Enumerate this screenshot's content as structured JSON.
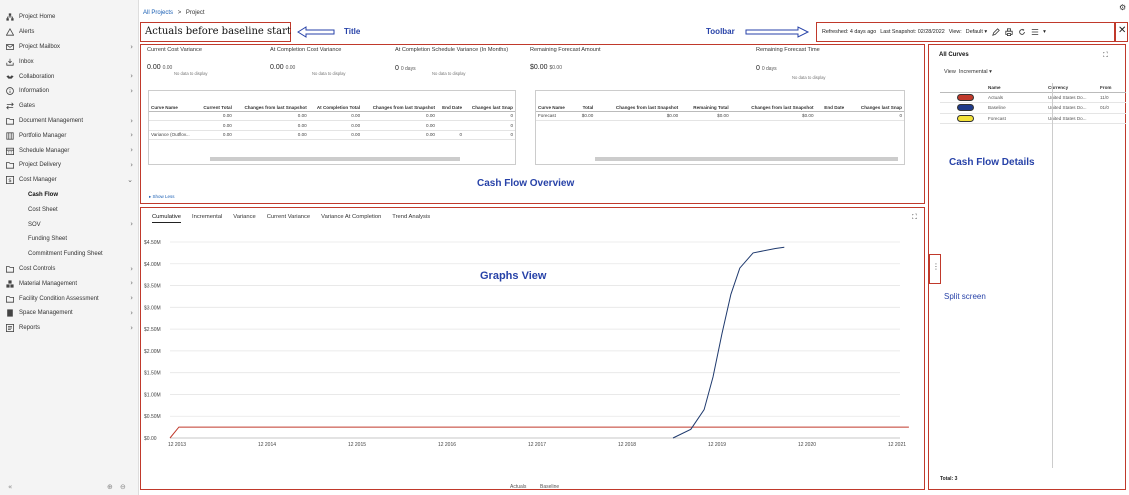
{
  "sidebar": {
    "items": [
      {
        "label": "Project Home",
        "icon": "hierarchy-icon",
        "chevron": ""
      },
      {
        "label": "Alerts",
        "icon": "warning-icon",
        "chevron": ""
      },
      {
        "label": "Project Mailbox",
        "icon": "mail-icon",
        "chevron": ">"
      },
      {
        "label": "Inbox",
        "icon": "inbox-icon",
        "chevron": ""
      },
      {
        "label": "Collaboration",
        "icon": "handshake-icon",
        "chevron": ">"
      },
      {
        "label": "Information",
        "icon": "info-icon",
        "chevron": ">"
      },
      {
        "label": "Gates",
        "icon": "arrows-icon",
        "chevron": ""
      },
      {
        "label": "Document Management",
        "icon": "folder-icon",
        "chevron": ">"
      },
      {
        "label": "Portfolio Manager",
        "icon": "building-icon",
        "chevron": ">"
      },
      {
        "label": "Schedule Manager",
        "icon": "calendar-icon",
        "chevron": ">"
      },
      {
        "label": "Project Delivery",
        "icon": "folder-icon",
        "chevron": ">"
      },
      {
        "label": "Cost Manager",
        "icon": "dollar-icon",
        "chevron": "v"
      },
      {
        "label": "Cash Flow",
        "sub": true,
        "active": true,
        "chevron": ""
      },
      {
        "label": "Cost Sheet",
        "sub": true,
        "chevron": ""
      },
      {
        "label": "SOV",
        "sub": true,
        "chevron": ">"
      },
      {
        "label": "Funding Sheet",
        "sub": true,
        "chevron": ""
      },
      {
        "label": "Commitment Funding Sheet",
        "sub": true,
        "chevron": ""
      },
      {
        "label": "Cost Controls",
        "icon": "folder-icon",
        "chevron": ">"
      },
      {
        "label": "Material Management",
        "icon": "boxes-icon",
        "chevron": ">"
      },
      {
        "label": "Facility Condition Assessment",
        "icon": "folder-icon",
        "chevron": ">"
      },
      {
        "label": "Space Management",
        "icon": "door-icon",
        "chevron": ">"
      },
      {
        "label": "Reports",
        "icon": "report-icon",
        "chevron": ">"
      }
    ],
    "bottom": {
      "collapse": "«",
      "zoom_in": "⊕",
      "zoom_out": "⊖"
    }
  },
  "header": {
    "breadcrumb_link": "All Projects",
    "breadcrumb_sep": ">",
    "breadcrumb_current": "Project",
    "title": "Actuals before baseline start"
  },
  "annotations": {
    "title": "Title",
    "toolbar": "Toolbar",
    "overview": "Cash Flow Overview",
    "graphs": "Graphs View",
    "details": "Cash Flow Details",
    "split": "Split screen"
  },
  "toolbar": {
    "refreshed": "Refreshed: 4 days ago",
    "last_snapshot": "Last Snapshot: 02/28/2022",
    "view_label": "View:",
    "view_value": "Default",
    "close": "✕"
  },
  "overview": {
    "metrics": [
      {
        "label": "Current Cost Variance",
        "value": "0.00",
        "sub": "0.00",
        "nodata": "No data to display"
      },
      {
        "label": "At Completion Cost Variance",
        "value": "0.00",
        "sub": "0.00",
        "nodata": "No data to display"
      },
      {
        "label": "At Completion Schedule Variance (In Months)",
        "value": "0",
        "sub": "0 days",
        "nodata": "No data to display"
      },
      {
        "label": "Remaining Forecast Amount",
        "value": "$0.00",
        "sub": "$0.00",
        "nodata": ""
      },
      {
        "label": "Remaining Forecast Time",
        "value": "0",
        "sub": "0 days",
        "nodata": "No data to display"
      }
    ],
    "left_table": {
      "headers": [
        "Curve Name",
        "Current Total",
        "Changes from last Snapshot",
        "At Completion Total",
        "Changes from last Snapshot",
        "End Date",
        "Changes last Snap"
      ],
      "rows": [
        [
          "",
          "0.00",
          "0.00",
          "0.00",
          "0.00",
          "",
          "0"
        ],
        [
          "",
          "0.00",
          "0.00",
          "0.00",
          "0.00",
          "",
          "0"
        ],
        [
          "Variance (Outflov...",
          "0.00",
          "0.00",
          "0.00",
          "0.00",
          "0",
          "0"
        ]
      ]
    },
    "right_table": {
      "headers": [
        "Curve Name",
        "Total",
        "Changes from last Snapshot",
        "Remaining Total",
        "Changes from last Snapshot",
        "End Date",
        "Changes last Snap"
      ],
      "rows": [
        [
          "Forecast",
          "$0.00",
          "$0.00",
          "$0.00",
          "$0.00",
          "",
          "0"
        ]
      ]
    },
    "show_less": "Show Less"
  },
  "graph": {
    "tabs": [
      "Cumulative",
      "Incremental",
      "Variance",
      "Current Variance",
      "Variance At Completion",
      "Trend Analysis"
    ],
    "active_tab": 0,
    "legend": [
      "Actuals",
      "Baseline"
    ]
  },
  "chart_data": {
    "type": "line",
    "x": [
      "12 2013",
      "12 2014",
      "12 2015",
      "12 2016",
      "12 2017",
      "12 2018",
      "12 2019",
      "12 2020",
      "12 2021"
    ],
    "y_ticks": [
      "$0.00",
      "$0.50M",
      "$1.00M",
      "$1.50M",
      "$2.00M",
      "$2.50M",
      "$3.00M",
      "$3.50M",
      "$4.00M",
      "$4.50M"
    ],
    "ylim": [
      0,
      4500000
    ],
    "series": [
      {
        "name": "Actuals",
        "color": "#c0392b",
        "points": [
          [
            2013.9,
            0
          ],
          [
            2014.0,
            250000
          ],
          [
            2022.2,
            250000
          ]
        ]
      },
      {
        "name": "Baseline",
        "color": "#1f3a6e",
        "points": [
          [
            2019.55,
            0
          ],
          [
            2019.75,
            200000
          ],
          [
            2019.9,
            650000
          ],
          [
            2020.0,
            1400000
          ],
          [
            2020.1,
            2400000
          ],
          [
            2020.2,
            3300000
          ],
          [
            2020.3,
            3900000
          ],
          [
            2020.45,
            4250000
          ],
          [
            2020.7,
            4350000
          ],
          [
            2020.8,
            4380000
          ]
        ]
      }
    ]
  },
  "details": {
    "title": "All Curves",
    "view_label": "View",
    "view_value": "Incremental",
    "headers": [
      "",
      "Name",
      "Currency",
      "From"
    ],
    "rows": [
      {
        "color": "#c0392b",
        "name": "Actuals",
        "currency": "United States Do...",
        "from": "11/0"
      },
      {
        "color": "#1f3a8a",
        "name": "Baseline",
        "currency": "United States Do...",
        "from": "01/0"
      },
      {
        "color": "#f4e23a",
        "name": "Forecast",
        "currency": "United States Do...",
        "from": ""
      }
    ],
    "total": "Total: 3"
  }
}
